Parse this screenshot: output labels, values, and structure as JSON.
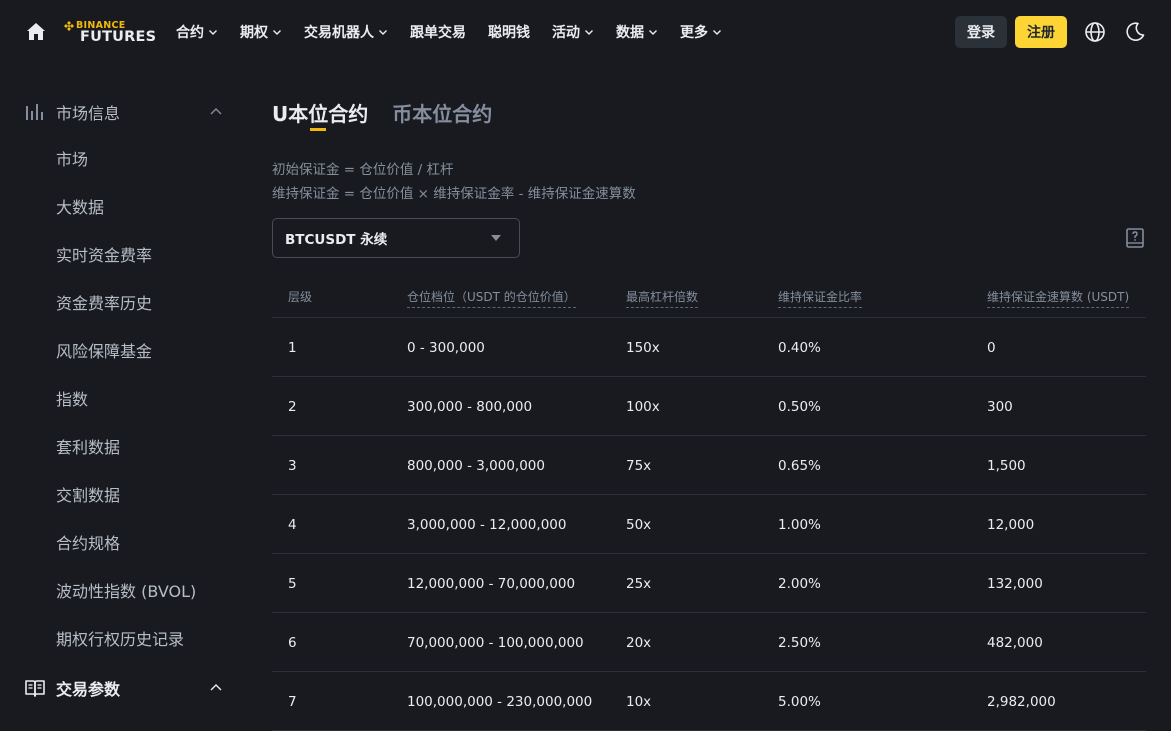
{
  "header": {
    "logo_top": "BINANCE",
    "logo_bottom": "FUTURES",
    "nav": [
      {
        "label": "合约",
        "has_dropdown": true
      },
      {
        "label": "期权",
        "has_dropdown": true
      },
      {
        "label": "交易机器人",
        "has_dropdown": true
      },
      {
        "label": "跟单交易",
        "has_dropdown": false
      },
      {
        "label": "聪明钱",
        "has_dropdown": false
      },
      {
        "label": "活动",
        "has_dropdown": true
      },
      {
        "label": "数据",
        "has_dropdown": true
      },
      {
        "label": "更多",
        "has_dropdown": true
      }
    ],
    "login_label": "登录",
    "register_label": "注册"
  },
  "sidebar": {
    "section1": {
      "title": "市场信息",
      "items": [
        "市场",
        "大数据",
        "实时资金费率",
        "资金费率历史",
        "风险保障基金",
        "指数",
        "套利数据",
        "交割数据",
        "合约规格",
        "波动性指数 (BVOL)",
        "期权行权历史记录"
      ]
    },
    "section2": {
      "title": "交易参数"
    }
  },
  "main": {
    "tabs": [
      {
        "label": "U本位合约",
        "active": true
      },
      {
        "label": "币本位合约",
        "active": false
      }
    ],
    "formula1": "初始保证金 = 仓位价值 / 杠杆",
    "formula2": "维持保证金 = 仓位价值 × 维持保证金率 - 维持保证金速算数",
    "selector_value": "BTCUSDT 永续",
    "table": {
      "headers": [
        "层级",
        "仓位档位（USDT 的仓位价值）",
        "最高杠杆倍数",
        "维持保证金比率",
        "维持保证金速算数 (USDT)"
      ],
      "rows": [
        [
          "1",
          "0 - 300,000",
          "150x",
          "0.40%",
          "0"
        ],
        [
          "2",
          "300,000 - 800,000",
          "100x",
          "0.50%",
          "300"
        ],
        [
          "3",
          "800,000 - 3,000,000",
          "75x",
          "0.65%",
          "1,500"
        ],
        [
          "4",
          "3,000,000 - 12,000,000",
          "50x",
          "1.00%",
          "12,000"
        ],
        [
          "5",
          "12,000,000 - 70,000,000",
          "25x",
          "2.00%",
          "132,000"
        ],
        [
          "6",
          "70,000,000 - 100,000,000",
          "20x",
          "2.50%",
          "482,000"
        ],
        [
          "7",
          "100,000,000 - 230,000,000",
          "10x",
          "5.00%",
          "2,982,000"
        ]
      ]
    }
  },
  "colors": {
    "background": "#181a20",
    "accent": "#f0b90b",
    "register_button": "#fcd535",
    "text_primary": "#eaecef",
    "text_secondary": "#848e9c"
  }
}
